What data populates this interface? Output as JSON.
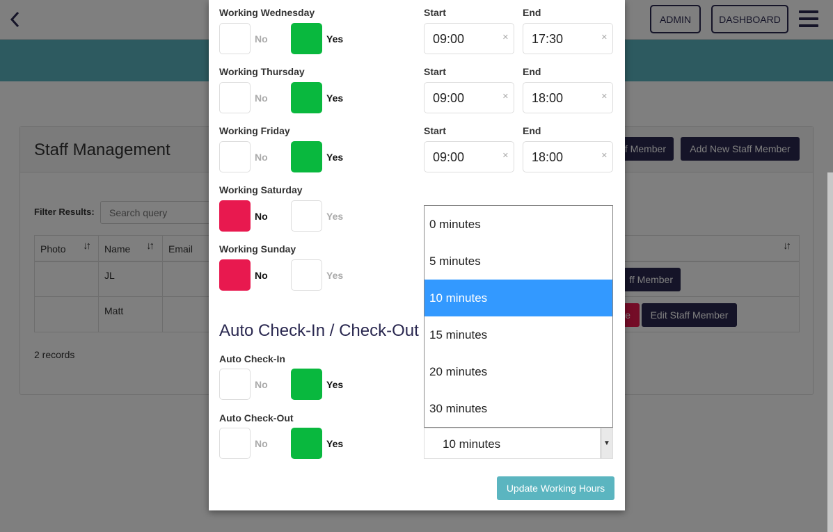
{
  "header": {
    "admin_label": "ADMIN",
    "dashboard_label": "DASHBOARD"
  },
  "page": {
    "title": "Staff Management",
    "staff_member_button_fragment": "f Member",
    "add_new_button": "Add New Staff Member",
    "filter_label": "Filter Results:",
    "search_placeholder": "Search query",
    "columns": [
      "Photo",
      "Name",
      "Email"
    ],
    "rows": [
      {
        "name": "JL",
        "action_fragment": "ff Member"
      },
      {
        "name": "Matt",
        "delete_fragment": "e",
        "edit_label": "Edit Staff Member"
      }
    ],
    "records": "2 records"
  },
  "modal": {
    "toggle_no": "No",
    "toggle_yes": "Yes",
    "start_label": "Start",
    "end_label": "End",
    "days": [
      {
        "label": "Working Wednesday",
        "working": true,
        "start": "09:00",
        "end": "17:30"
      },
      {
        "label": "Working Thursday",
        "working": true,
        "start": "09:00",
        "end": "18:00"
      },
      {
        "label": "Working Friday",
        "working": true,
        "start": "09:00",
        "end": "18:00"
      },
      {
        "label": "Working Saturday",
        "working": false
      },
      {
        "label": "Working Sunday",
        "working": false
      }
    ],
    "auto_section_title": "Auto Check-In / Check-Out",
    "auto_checkin_label": "Auto Check-In",
    "auto_checkin_value": true,
    "auto_checkout_label": "Auto Check-Out",
    "auto_checkout_value": true,
    "select_value": "10 minutes",
    "select_options": [
      "0 minutes",
      "5 minutes",
      "10 minutes",
      "15 minutes",
      "20 minutes",
      "30 minutes"
    ],
    "selected_option_index": 2,
    "update_button": "Update Working Hours"
  },
  "colors": {
    "accent_dark": "#2a2850",
    "teal": "#5bb5c0",
    "toggle_yes": "#09b83e",
    "toggle_no": "#e8194f",
    "dropdown_highlight": "#3399ff"
  }
}
